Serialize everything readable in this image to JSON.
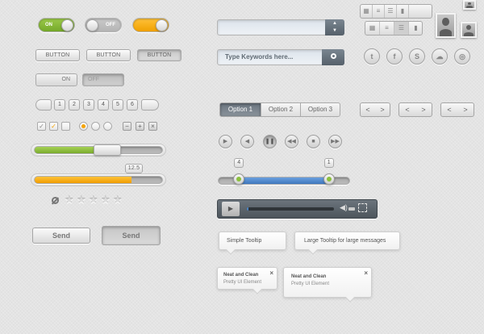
{
  "toggles": [
    {
      "label": "ON",
      "state": "on",
      "color": "#84b536"
    },
    {
      "label": "OFF",
      "state": "off",
      "color": "#bdbdbd"
    },
    {
      "label": "",
      "state": "on",
      "color": "#f5a300"
    }
  ],
  "buttons": {
    "b1": "BUTTON",
    "b2": "BUTTON",
    "b3": "BUTTON"
  },
  "segmented_toggle": {
    "on": "ON",
    "off": "OFF"
  },
  "pagination": [
    "1",
    "2",
    "3",
    "4",
    "5",
    "6"
  ],
  "sliders": {
    "progress_green": 0.57,
    "progress_orange": 0.75,
    "orange_value": "12.5"
  },
  "rating": {
    "value": 0,
    "max": 5
  },
  "send_buttons": {
    "normal": "Send",
    "pressed": "Send"
  },
  "search": {
    "placeholder": "Type Keywords here..."
  },
  "option_tabs": [
    "Option 1",
    "Option 2",
    "Option 3"
  ],
  "range_slider": {
    "left_value": "4",
    "right_value": "1",
    "left": 0.16,
    "right": 0.84
  },
  "video_player": {
    "progress": 0.02
  },
  "tooltips": {
    "simple": "Simple Tooltip",
    "large": "Large Tooltip for large messages",
    "card_title": "Neat and Clean",
    "card_sub": "Pretty UI Element",
    "card2_title": "Neat and Clean",
    "card2_sub": "Pretty UI Element"
  },
  "colors": {
    "green": "#84b536",
    "orange": "#f5a300",
    "blue": "#4c86c8",
    "dark": "#5f6870"
  }
}
